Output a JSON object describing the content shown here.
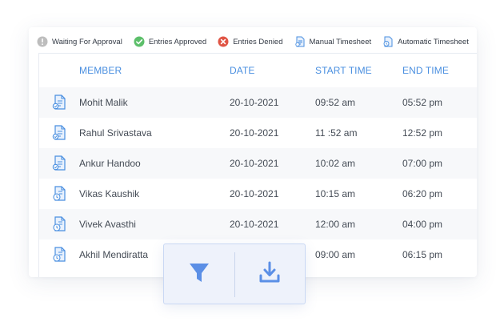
{
  "legend": [
    {
      "label": "Waiting For Approval",
      "icon": "clock-gray-icon",
      "color": "#b9b9b9"
    },
    {
      "label": "Entries Approved",
      "icon": "check-circle-icon",
      "color": "#5cbf6a"
    },
    {
      "label": "Entries Denied",
      "icon": "x-circle-icon",
      "color": "#e05545"
    },
    {
      "label": "Manual Timesheet",
      "icon": "manual-timesheet-icon",
      "color": "#4a8fe0"
    },
    {
      "label": "Automatic Timesheet",
      "icon": "automatic-timesheet-icon",
      "color": "#4a8fe0"
    }
  ],
  "table": {
    "headers": {
      "member": "MEMBER",
      "date": "DATE",
      "start": "START TIME",
      "end": "END TIME"
    },
    "rows": [
      {
        "type": "manual",
        "member": "Mohit Malik",
        "date": "20-10-2021",
        "start": "09:52 am",
        "end": "05:52 pm"
      },
      {
        "type": "manual",
        "member": "Rahul Srivastava",
        "date": "20-10-2021",
        "start": "11 :52 am",
        "end": "12:52 pm"
      },
      {
        "type": "manual",
        "member": "Ankur Handoo",
        "date": "20-10-2021",
        "start": "10:02 am",
        "end": "07:00 pm"
      },
      {
        "type": "automatic",
        "member": "Vikas Kaushik",
        "date": "20-10-2021",
        "start": "10:15 am",
        "end": "06:20 pm"
      },
      {
        "type": "automatic",
        "member": "Vivek Avasthi",
        "date": "20-10-2021",
        "start": "12:00 am",
        "end": "04:00 pm"
      },
      {
        "type": "automatic",
        "member": "Akhil Mendiratta",
        "date": "",
        "start": "09:00 am",
        "end": "06:15 pm"
      }
    ]
  },
  "toolbar": {
    "filter_icon": "filter-icon",
    "download_icon": "download-icon",
    "accent": "#5b8fe6"
  }
}
